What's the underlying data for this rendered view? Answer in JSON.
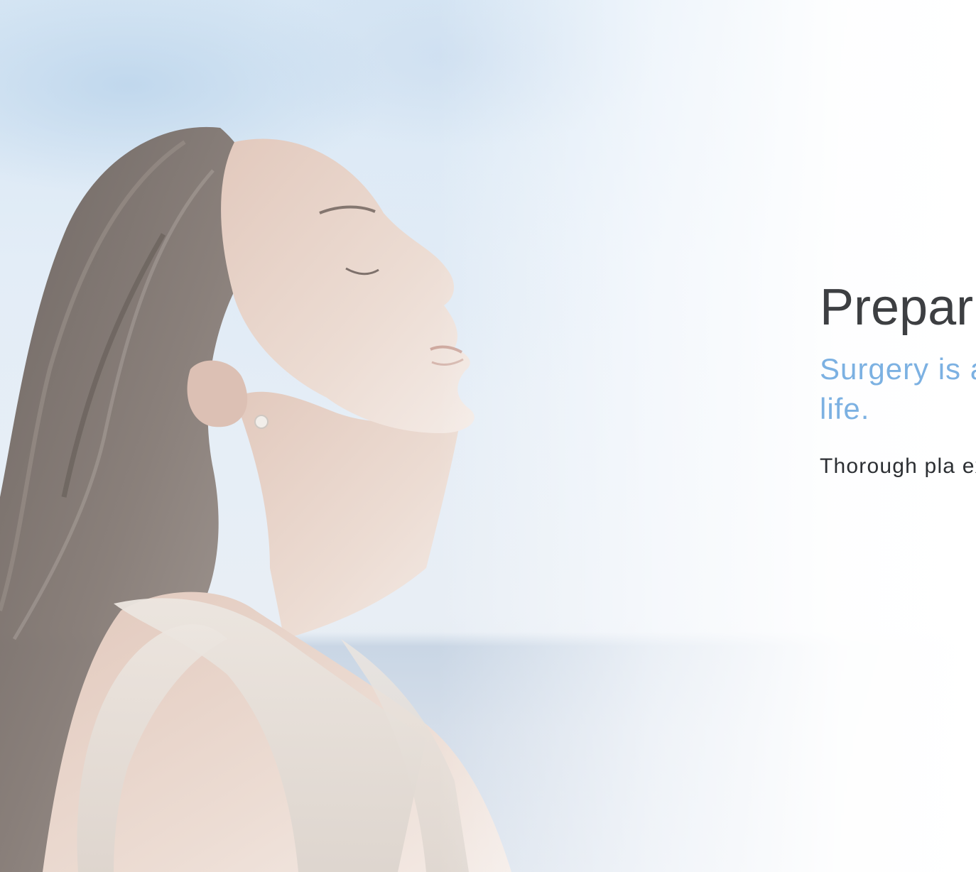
{
  "hero": {
    "title": "Prepar",
    "subtitle": "Surgery is a short tim your life.",
    "body": "Thorough pla experience is your expecta"
  },
  "colors": {
    "title": "#3d3f42",
    "subtitle_accent": "#7cb1e2",
    "body_text": "#2c2f33"
  }
}
